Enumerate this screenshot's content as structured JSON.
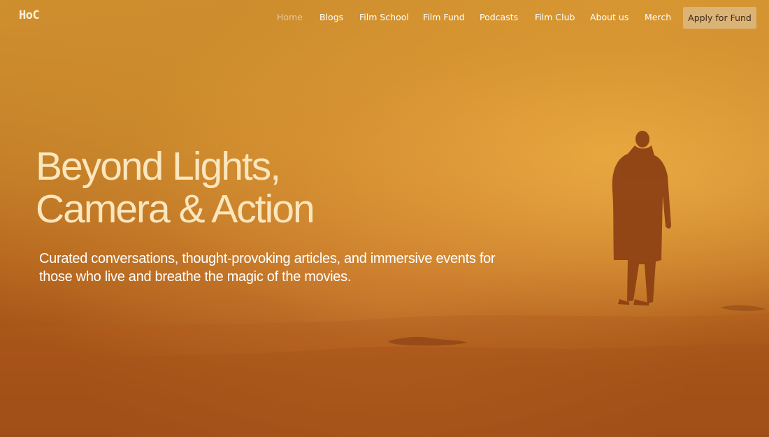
{
  "brand": {
    "logo_text": "HoC"
  },
  "nav": {
    "items": [
      {
        "label": "Home",
        "active": true
      },
      {
        "label": "Blogs",
        "active": false
      },
      {
        "label": "Film School",
        "active": false
      },
      {
        "label": "Film Fund",
        "active": false
      },
      {
        "label": "Podcasts",
        "active": false
      },
      {
        "label": "Film Club",
        "active": false
      },
      {
        "label": "About us",
        "active": false
      },
      {
        "label": "Merch",
        "active": false
      }
    ],
    "cta_label": "Apply for Fund"
  },
  "hero": {
    "title_line1": "Beyond Lights,",
    "title_line2": "Camera & Action",
    "subtitle_line1": "Curated conversations, thought-provoking articles, and immersive events for",
    "subtitle_line2": "those who live and breathe the magic of the movies."
  },
  "colors": {
    "background_top": "#d09230",
    "background_bottom": "#8f4313",
    "title": "#fbe6bd",
    "cta_background": "#dcb376",
    "nav_active": "#e7c79b"
  }
}
